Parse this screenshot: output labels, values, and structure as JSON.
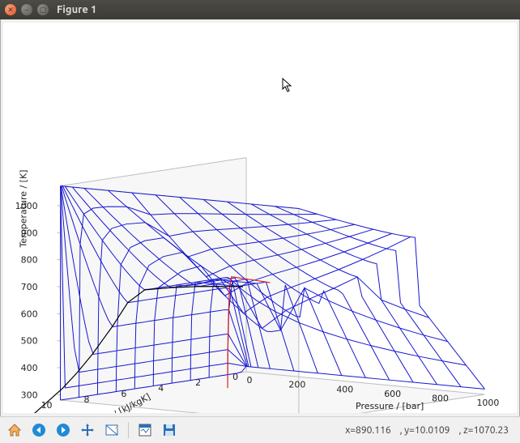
{
  "window": {
    "title": "Figure 1"
  },
  "toolbar": {
    "home": "Home",
    "back": "Back",
    "forward": "Forward",
    "pan": "Pan",
    "zoom": "Zoom",
    "subplots": "Configure subplots",
    "save": "Save"
  },
  "status": {
    "x_label": "x=",
    "x_val": "890.116",
    "y_label": ", y=",
    "y_val": "10.0109",
    "z_label": ", z=",
    "z_val": "1070.23"
  },
  "chart_data": {
    "type": "surface-wireframe",
    "title": "",
    "axes": {
      "x": {
        "label": "Pressure / [bar]",
        "ticks": [
          0,
          200,
          400,
          600,
          800,
          1000
        ],
        "range": [
          0,
          1000
        ]
      },
      "y": {
        "label": "Entropy / [kJ/kgK]",
        "ticks": [
          0,
          2,
          4,
          6,
          8,
          10
        ],
        "range": [
          0,
          10
        ]
      },
      "z": {
        "label": "Temperature / [K]",
        "ticks": [
          300,
          400,
          500,
          600,
          700,
          800,
          900,
          1000
        ],
        "range": [
          280,
          1073
        ]
      }
    },
    "description": "Wireframe surface T(s, P). Dense isobars at low pressure; surface flattens and rises toward 1000 bar. Red saturation curve at low entropy, black boundary near the ridge.",
    "overlays": [
      {
        "name": "saturation-liquid",
        "color": "#e02020"
      },
      {
        "name": "saturation-vapor",
        "color": "#000000"
      }
    ],
    "pressure_lines_bar": [
      0.1,
      0.5,
      1,
      2,
      5,
      10,
      20,
      50,
      100,
      200,
      300,
      400,
      500,
      600,
      700,
      800,
      900,
      1000
    ],
    "entropy_grid_kJ_per_kgK": [
      0,
      1,
      2,
      3,
      4,
      5,
      6,
      7,
      8,
      9,
      10
    ]
  }
}
